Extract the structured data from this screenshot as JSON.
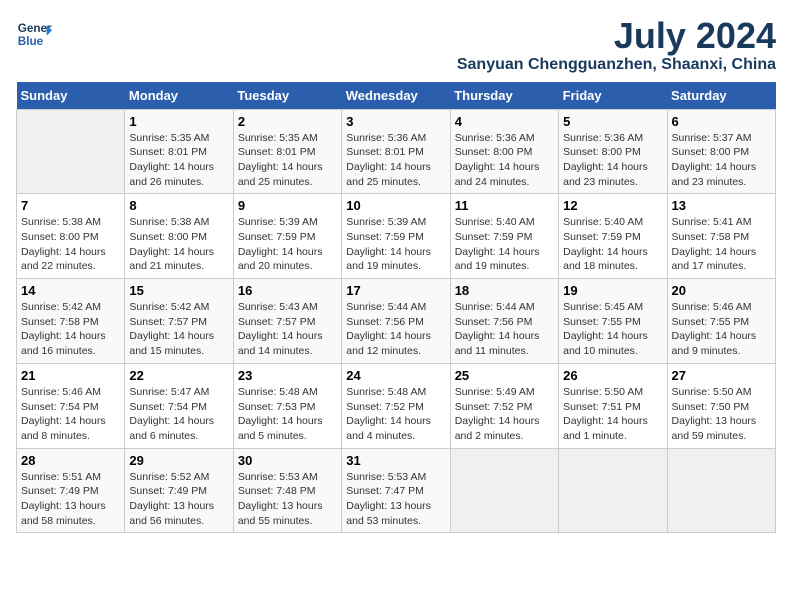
{
  "header": {
    "logo_line1": "General",
    "logo_line2": "Blue",
    "main_title": "July 2024",
    "subtitle": "Sanyuan Chengguanzhen, Shaanxi, China"
  },
  "days_of_week": [
    "Sunday",
    "Monday",
    "Tuesday",
    "Wednesday",
    "Thursday",
    "Friday",
    "Saturday"
  ],
  "weeks": [
    {
      "cells": [
        {
          "day": "",
          "empty": true
        },
        {
          "day": "1",
          "rise": "Sunrise: 5:35 AM",
          "set": "Sunset: 8:01 PM",
          "daylight": "Daylight: 14 hours and 26 minutes."
        },
        {
          "day": "2",
          "rise": "Sunrise: 5:35 AM",
          "set": "Sunset: 8:01 PM",
          "daylight": "Daylight: 14 hours and 25 minutes."
        },
        {
          "day": "3",
          "rise": "Sunrise: 5:36 AM",
          "set": "Sunset: 8:01 PM",
          "daylight": "Daylight: 14 hours and 25 minutes."
        },
        {
          "day": "4",
          "rise": "Sunrise: 5:36 AM",
          "set": "Sunset: 8:00 PM",
          "daylight": "Daylight: 14 hours and 24 minutes."
        },
        {
          "day": "5",
          "rise": "Sunrise: 5:36 AM",
          "set": "Sunset: 8:00 PM",
          "daylight": "Daylight: 14 hours and 23 minutes."
        },
        {
          "day": "6",
          "rise": "Sunrise: 5:37 AM",
          "set": "Sunset: 8:00 PM",
          "daylight": "Daylight: 14 hours and 23 minutes."
        }
      ]
    },
    {
      "cells": [
        {
          "day": "7",
          "rise": "Sunrise: 5:38 AM",
          "set": "Sunset: 8:00 PM",
          "daylight": "Daylight: 14 hours and 22 minutes."
        },
        {
          "day": "8",
          "rise": "Sunrise: 5:38 AM",
          "set": "Sunset: 8:00 PM",
          "daylight": "Daylight: 14 hours and 21 minutes."
        },
        {
          "day": "9",
          "rise": "Sunrise: 5:39 AM",
          "set": "Sunset: 7:59 PM",
          "daylight": "Daylight: 14 hours and 20 minutes."
        },
        {
          "day": "10",
          "rise": "Sunrise: 5:39 AM",
          "set": "Sunset: 7:59 PM",
          "daylight": "Daylight: 14 hours and 19 minutes."
        },
        {
          "day": "11",
          "rise": "Sunrise: 5:40 AM",
          "set": "Sunset: 7:59 PM",
          "daylight": "Daylight: 14 hours and 19 minutes."
        },
        {
          "day": "12",
          "rise": "Sunrise: 5:40 AM",
          "set": "Sunset: 7:59 PM",
          "daylight": "Daylight: 14 hours and 18 minutes."
        },
        {
          "day": "13",
          "rise": "Sunrise: 5:41 AM",
          "set": "Sunset: 7:58 PM",
          "daylight": "Daylight: 14 hours and 17 minutes."
        }
      ]
    },
    {
      "cells": [
        {
          "day": "14",
          "rise": "Sunrise: 5:42 AM",
          "set": "Sunset: 7:58 PM",
          "daylight": "Daylight: 14 hours and 16 minutes."
        },
        {
          "day": "15",
          "rise": "Sunrise: 5:42 AM",
          "set": "Sunset: 7:57 PM",
          "daylight": "Daylight: 14 hours and 15 minutes."
        },
        {
          "day": "16",
          "rise": "Sunrise: 5:43 AM",
          "set": "Sunset: 7:57 PM",
          "daylight": "Daylight: 14 hours and 14 minutes."
        },
        {
          "day": "17",
          "rise": "Sunrise: 5:44 AM",
          "set": "Sunset: 7:56 PM",
          "daylight": "Daylight: 14 hours and 12 minutes."
        },
        {
          "day": "18",
          "rise": "Sunrise: 5:44 AM",
          "set": "Sunset: 7:56 PM",
          "daylight": "Daylight: 14 hours and 11 minutes."
        },
        {
          "day": "19",
          "rise": "Sunrise: 5:45 AM",
          "set": "Sunset: 7:55 PM",
          "daylight": "Daylight: 14 hours and 10 minutes."
        },
        {
          "day": "20",
          "rise": "Sunrise: 5:46 AM",
          "set": "Sunset: 7:55 PM",
          "daylight": "Daylight: 14 hours and 9 minutes."
        }
      ]
    },
    {
      "cells": [
        {
          "day": "21",
          "rise": "Sunrise: 5:46 AM",
          "set": "Sunset: 7:54 PM",
          "daylight": "Daylight: 14 hours and 8 minutes."
        },
        {
          "day": "22",
          "rise": "Sunrise: 5:47 AM",
          "set": "Sunset: 7:54 PM",
          "daylight": "Daylight: 14 hours and 6 minutes."
        },
        {
          "day": "23",
          "rise": "Sunrise: 5:48 AM",
          "set": "Sunset: 7:53 PM",
          "daylight": "Daylight: 14 hours and 5 minutes."
        },
        {
          "day": "24",
          "rise": "Sunrise: 5:48 AM",
          "set": "Sunset: 7:52 PM",
          "daylight": "Daylight: 14 hours and 4 minutes."
        },
        {
          "day": "25",
          "rise": "Sunrise: 5:49 AM",
          "set": "Sunset: 7:52 PM",
          "daylight": "Daylight: 14 hours and 2 minutes."
        },
        {
          "day": "26",
          "rise": "Sunrise: 5:50 AM",
          "set": "Sunset: 7:51 PM",
          "daylight": "Daylight: 14 hours and 1 minute."
        },
        {
          "day": "27",
          "rise": "Sunrise: 5:50 AM",
          "set": "Sunset: 7:50 PM",
          "daylight": "Daylight: 13 hours and 59 minutes."
        }
      ]
    },
    {
      "cells": [
        {
          "day": "28",
          "rise": "Sunrise: 5:51 AM",
          "set": "Sunset: 7:49 PM",
          "daylight": "Daylight: 13 hours and 58 minutes."
        },
        {
          "day": "29",
          "rise": "Sunrise: 5:52 AM",
          "set": "Sunset: 7:49 PM",
          "daylight": "Daylight: 13 hours and 56 minutes."
        },
        {
          "day": "30",
          "rise": "Sunrise: 5:53 AM",
          "set": "Sunset: 7:48 PM",
          "daylight": "Daylight: 13 hours and 55 minutes."
        },
        {
          "day": "31",
          "rise": "Sunrise: 5:53 AM",
          "set": "Sunset: 7:47 PM",
          "daylight": "Daylight: 13 hours and 53 minutes."
        },
        {
          "day": "",
          "empty": true
        },
        {
          "day": "",
          "empty": true
        },
        {
          "day": "",
          "empty": true
        }
      ]
    }
  ]
}
